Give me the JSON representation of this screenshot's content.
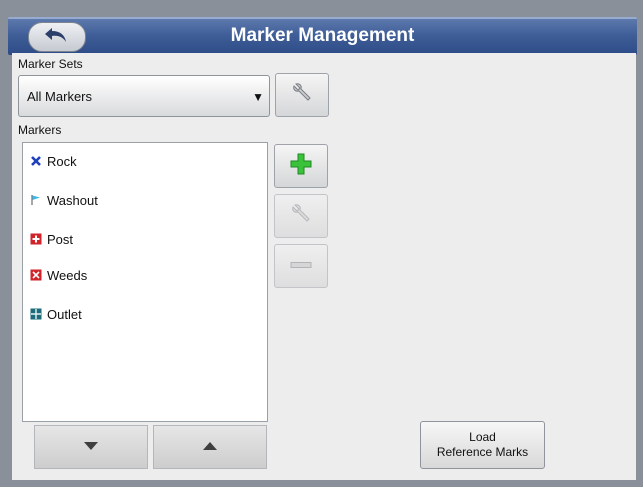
{
  "header": {
    "title": "Marker Management",
    "back_icon": "back-arrow-icon"
  },
  "marker_sets": {
    "label": "Marker Sets",
    "selected": "All Markers",
    "dropdown_icon": "dropdown-triangle-icon",
    "edit_icon": "wrench-icon"
  },
  "markers": {
    "label": "Markers",
    "items": [
      {
        "label": "Rock",
        "icon": "blue-x-icon",
        "color": "#1f3fbf"
      },
      {
        "label": "Washout",
        "icon": "flag-icon",
        "color": "#3fb7e6"
      },
      {
        "label": "Post",
        "icon": "red-cross-icon",
        "color": "#d1232a"
      },
      {
        "label": "Weeds",
        "icon": "red-x-box-icon",
        "color": "#d1232a"
      },
      {
        "label": "Outlet",
        "icon": "teal-grid-icon",
        "color": "#1b6b7a"
      }
    ]
  },
  "actions": {
    "add_icon": "green-plus-icon",
    "edit_icon": "wrench-icon",
    "remove_icon": "minus-icon"
  },
  "scroll": {
    "down_icon": "chevron-down-icon",
    "up_icon": "chevron-up-icon"
  },
  "load_button": {
    "line1": "Load",
    "line2": "Reference Marks"
  },
  "colors": {
    "header": "#3f5e98",
    "add_green": "#39c23a"
  }
}
